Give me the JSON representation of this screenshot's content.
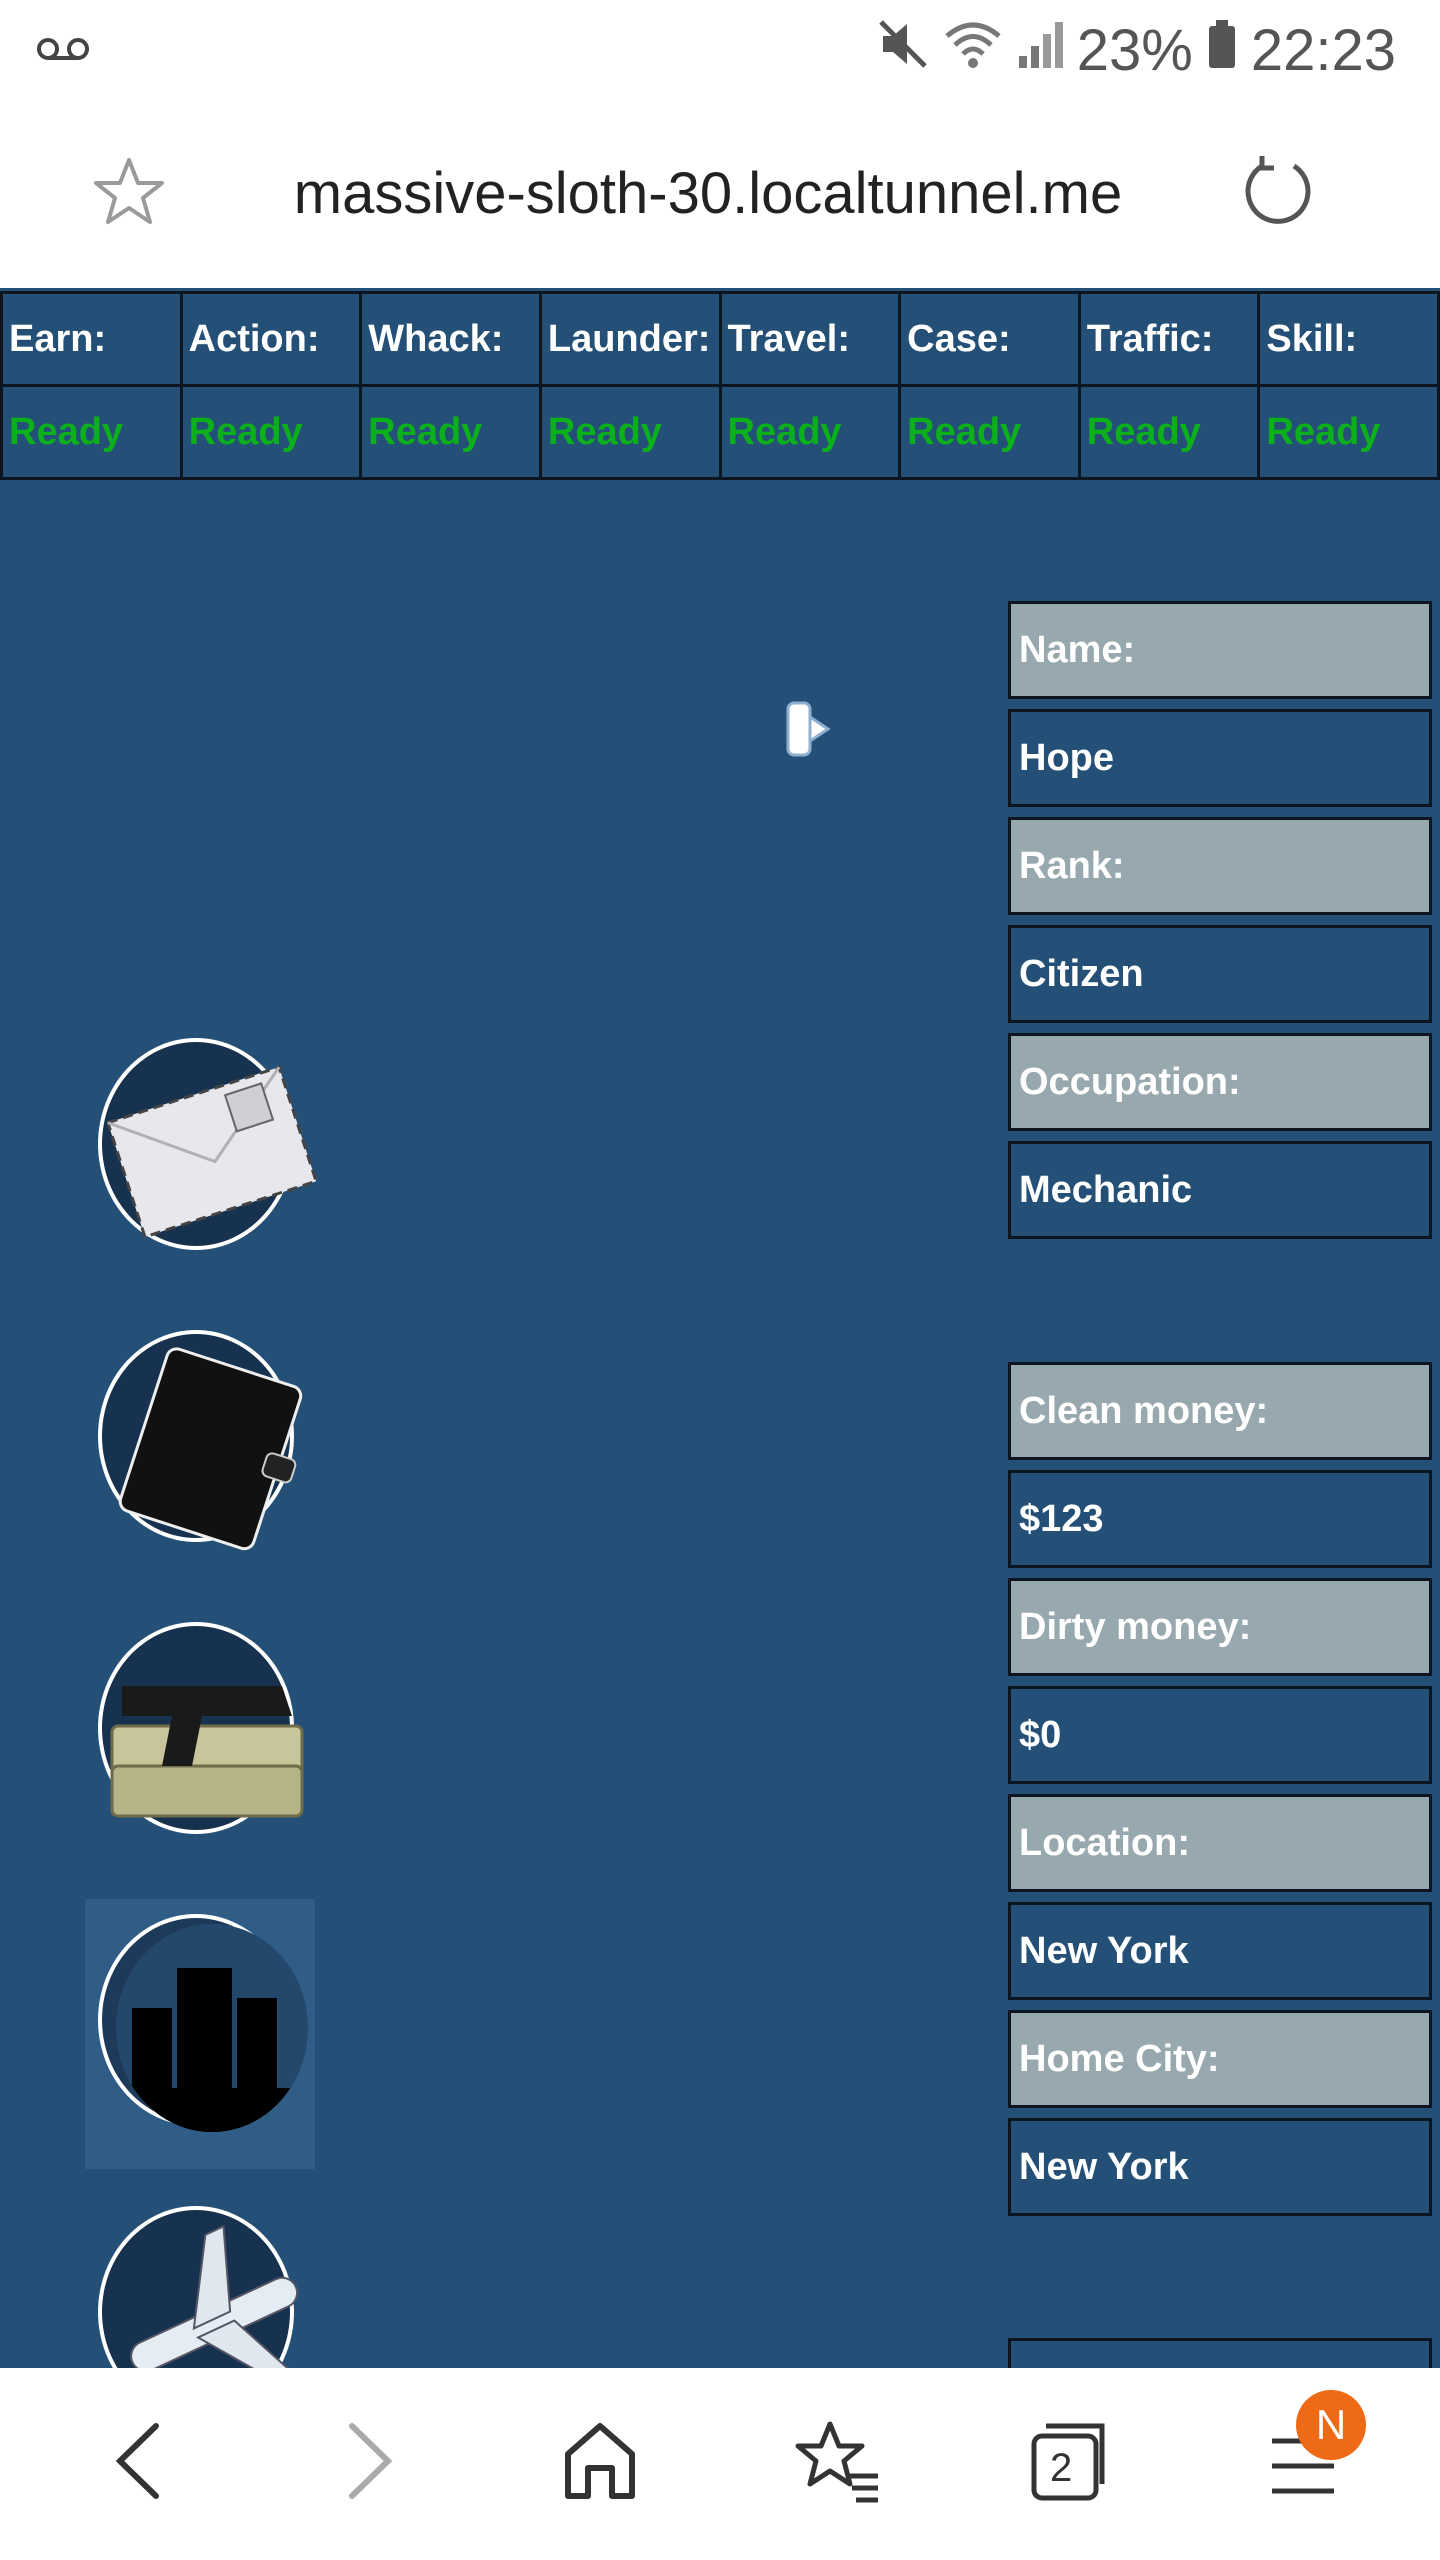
{
  "status_bar": {
    "battery": "23%",
    "time": "22:23",
    "icons": [
      "voicemail-icon",
      "mute-icon",
      "wifi-icon",
      "signal-icon",
      "battery-icon"
    ]
  },
  "browser": {
    "url": "massive-sloth-30.localtunnel.me",
    "icons": [
      "bookmark-star-icon",
      "reload-icon"
    ]
  },
  "timers": [
    {
      "label": "Earn:",
      "status": "Ready"
    },
    {
      "label": "Action:",
      "status": "Ready"
    },
    {
      "label": "Whack:",
      "status": "Ready"
    },
    {
      "label": "Launder:",
      "status": "Ready"
    },
    {
      "label": "Travel:",
      "status": "Ready"
    },
    {
      "label": "Case:",
      "status": "Ready"
    },
    {
      "label": "Traffic:",
      "status": "Ready"
    },
    {
      "label": "Skill:",
      "status": "Ready"
    }
  ],
  "menu_icons": [
    "mail-icon",
    "notebook-icon",
    "gun-money-icon",
    "city-icon",
    "airplane-icon"
  ],
  "player": {
    "name_label": "Name:",
    "name": "Hope",
    "rank_label": "Rank:",
    "rank": "Citizen",
    "occupation_label": "Occupation:",
    "occupation": "Mechanic",
    "clean_money_label": "Clean money:",
    "clean_money": "$123",
    "dirty_money_label": "Dirty money:",
    "dirty_money": "$0",
    "location_label": "Location:",
    "location": "New York",
    "home_city_label": "Home City:",
    "home_city": "New York"
  },
  "colors": {
    "page_bg": "#245077",
    "ready": "#0bb01b",
    "label_bg": "#97a8af",
    "badge": "#ef6a17"
  },
  "bottom_nav": {
    "tabs_count": "2",
    "badge": "N",
    "icons": [
      "back-icon",
      "forward-icon",
      "home-icon",
      "bookmarks-icon",
      "tabs-icon",
      "menu-icon"
    ]
  }
}
